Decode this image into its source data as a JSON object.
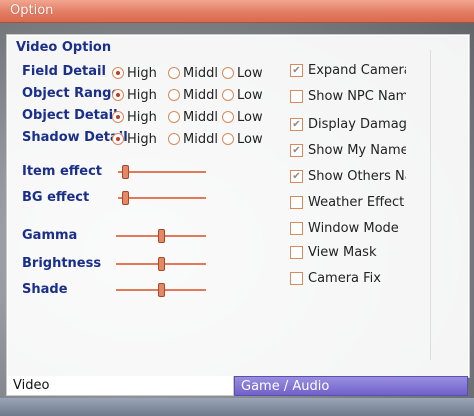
{
  "window": {
    "title": "Option"
  },
  "section": {
    "title": "Video Option"
  },
  "detail_rows": [
    {
      "label": "Field Detail",
      "options": [
        "High",
        "Middle",
        "Low"
      ],
      "selected": "High"
    },
    {
      "label": "Object Range",
      "options": [
        "High",
        "Middle",
        "Low"
      ],
      "selected": "High"
    },
    {
      "label": "Object Detail",
      "options": [
        "High",
        "Middle",
        "Low"
      ],
      "selected": "High"
    },
    {
      "label": "Shadow Detail",
      "options": [
        "High",
        "Middle",
        "Low"
      ],
      "selected": "High"
    }
  ],
  "sliders": [
    {
      "label": "Item effect",
      "value": 0.05
    },
    {
      "label": "BG effect",
      "value": 0.05
    },
    {
      "label": "Gamma",
      "value": 0.5
    },
    {
      "label": "Brightness",
      "value": 0.5
    },
    {
      "label": "Shade",
      "value": 0.5
    }
  ],
  "checkboxes": [
    {
      "label": "Expand Camera",
      "checked": true
    },
    {
      "label": "Show NPC Name",
      "checked": false
    },
    {
      "label": "Display Damage",
      "checked": true
    },
    {
      "label": "Show My Name",
      "checked": true
    },
    {
      "label": "Show Others Name",
      "checked": true
    },
    {
      "label": "Weather Effect",
      "checked": false
    },
    {
      "label": "Window Mode",
      "checked": false
    },
    {
      "label": "View Mask",
      "checked": false
    },
    {
      "label": "Camera Fix",
      "checked": false
    }
  ],
  "tabs": [
    {
      "label": "Video",
      "active": true
    },
    {
      "label": "Game / Audio",
      "active": false
    }
  ],
  "colors": {
    "title_bar": "#e27d64",
    "label_blue": "#1a2f8a",
    "accent": "#e07a5a"
  }
}
